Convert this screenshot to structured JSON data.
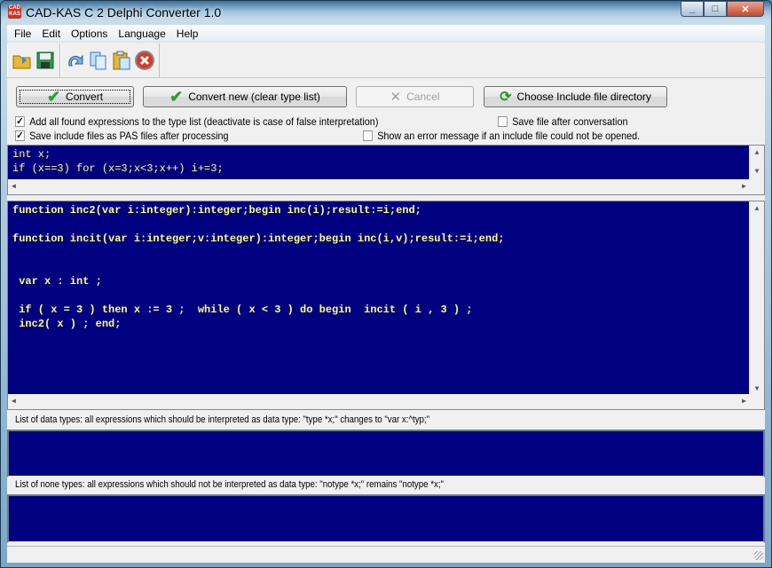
{
  "window": {
    "title": "CAD-KAS C 2 Delphi Converter 1.0",
    "app_icon_text": "CAD KAS"
  },
  "menu": [
    "File",
    "Edit",
    "Options",
    "Language",
    "Help"
  ],
  "toolbar": {
    "icons": [
      "open-folder-icon",
      "save-icon",
      "undo-icon",
      "copy-icon",
      "paste-icon",
      "delete-icon"
    ]
  },
  "buttons": {
    "convert": "Convert",
    "convert_new": "Convert new (clear type list)",
    "cancel": "Cancel",
    "choose_dir": "Choose Include file directory"
  },
  "options": {
    "add_expressions": {
      "label": "Add all found expressions to the type list (deactivate is case of false interpretation)",
      "checked": true
    },
    "save_pas": {
      "label": "Save include files as PAS files after processing",
      "checked": true
    },
    "save_after": {
      "label": "Save file after conversation",
      "checked": false
    },
    "show_error": {
      "label": "Show an error message if an include file could not be opened.",
      "checked": false
    }
  },
  "input_code": "int x;\nif (x==3) for (x=3;x<3;x++) i+=3;",
  "output_code": "function inc2(var i:integer):integer;begin inc(i);result:=i;end;\n\nfunction incit(var i:integer;v:integer):integer;begin inc(i,v);result:=i;end;\n\n\n var x : int ;\n\n if ( x = 3 ) then x := 3 ;  while ( x < 3 ) do begin  incit ( i , 3 ) ;\n inc2( x ) ; end;",
  "data_types_label": "List of data types: all expressions which should be interpreted as data type: \"type *x;\" changes to \"var x:^typ;\"",
  "none_types_label": "List of none types: all expressions which should not be interpreted as data type: \"notype *x;\" remains \"notype *x;\"",
  "colors": {
    "memo_bg": "#000080",
    "memo_text": "#ffff80"
  }
}
